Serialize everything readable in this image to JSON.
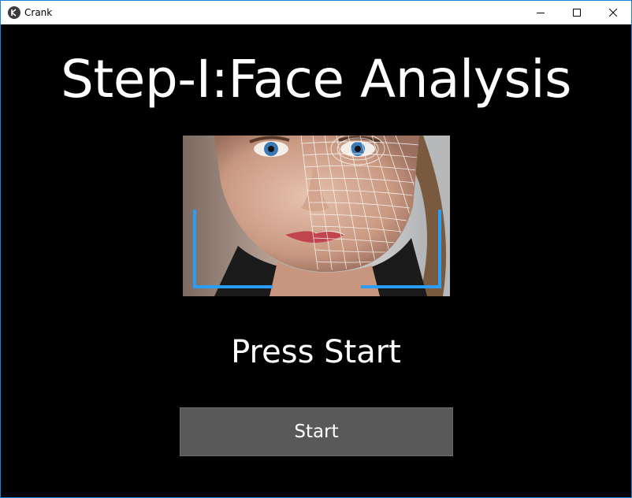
{
  "window": {
    "title": "Crank",
    "icon": "kivy-app-icon",
    "controls": {
      "minimize": "minimize-icon",
      "maximize": "maximize-icon",
      "close": "close-icon"
    },
    "accent_border": "#1883d7"
  },
  "main": {
    "heading": "Step-I:Face Analysis",
    "image": "face-analysis-mesh-image",
    "status_text": "Press Start",
    "start_button_label": "Start",
    "background": "#000000",
    "button_color": "#595959",
    "bracket_color": "#2a9df4"
  }
}
